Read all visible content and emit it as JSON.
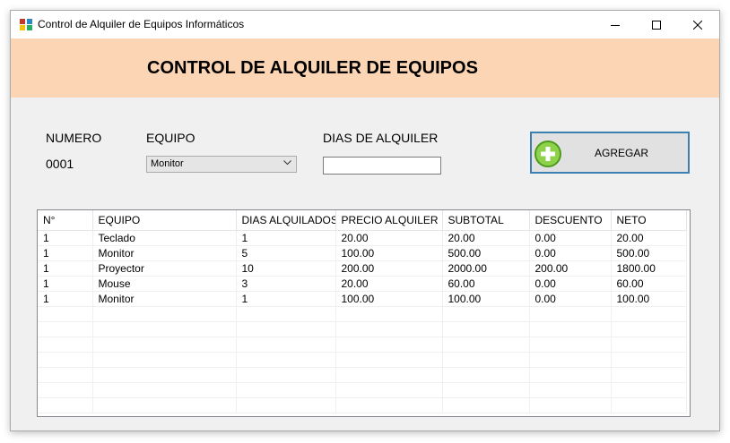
{
  "window": {
    "title": "Control de Alquiler de Equipos Informáticos",
    "controls": [
      "minimize-icon",
      "maximize-icon",
      "close-icon"
    ]
  },
  "header": {
    "title": "CONTROL DE ALQUILER DE EQUIPOS",
    "background_color": "#fcd5b4"
  },
  "form": {
    "numero_label": "NUMERO",
    "numero_value": "0001",
    "equipo_label": "EQUIPO",
    "equipo_selected": "Monitor",
    "dias_label": "DIAS DE ALQUILER",
    "dias_value": "",
    "add_button_label": "AGREGAR",
    "add_button_icon": "plus-circle-icon",
    "accent_color": "#3c7fb1"
  },
  "grid": {
    "columns": [
      "N°",
      "EQUIPO",
      "DIAS ALQUILADOS",
      "PRECIO ALQUILER",
      "SUBTOTAL",
      "DESCUENTO",
      "NETO"
    ],
    "rows": [
      [
        "1",
        "Teclado",
        "1",
        "20.00",
        "20.00",
        "0.00",
        "20.00"
      ],
      [
        "1",
        "Monitor",
        "5",
        "100.00",
        "500.00",
        "0.00",
        "500.00"
      ],
      [
        "1",
        "Proyector",
        "10",
        "200.00",
        "2000.00",
        "200.00",
        "1800.00"
      ],
      [
        "1",
        "Mouse",
        "3",
        "20.00",
        "60.00",
        "0.00",
        "60.00"
      ],
      [
        "1",
        "Monitor",
        "1",
        "100.00",
        "100.00",
        "0.00",
        "100.00"
      ]
    ]
  }
}
